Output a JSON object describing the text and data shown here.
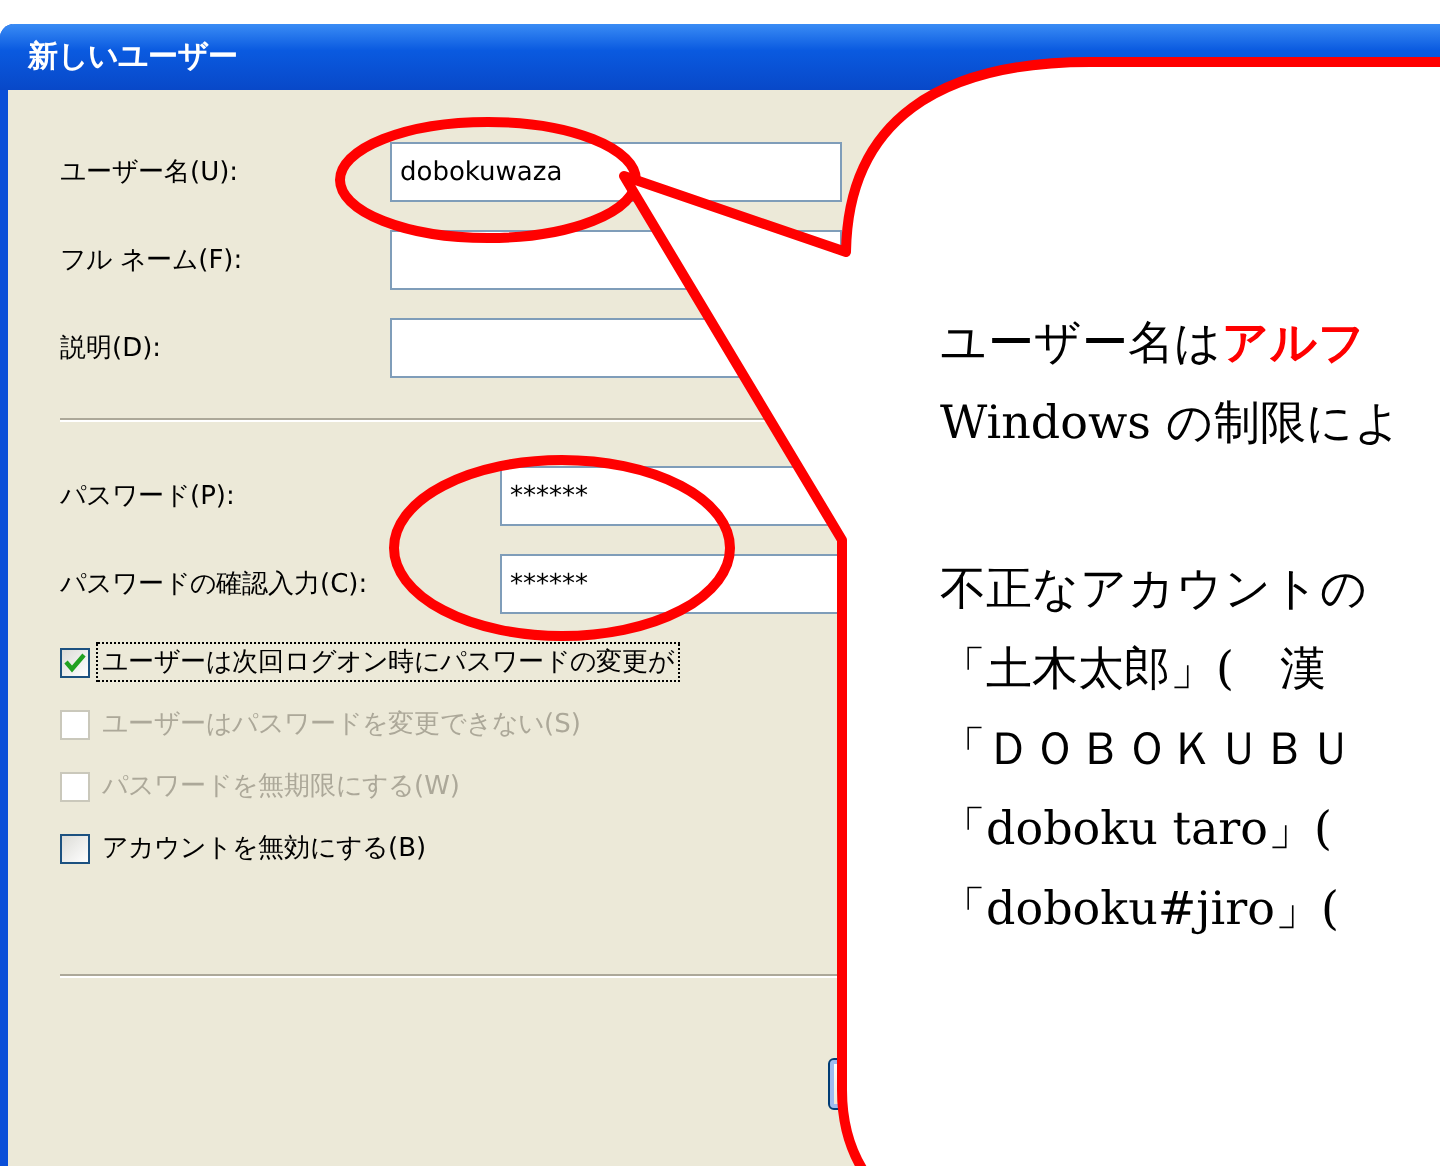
{
  "window": {
    "title": "新しいユーザー"
  },
  "fields": [
    {
      "label": "ユーザー名(U):",
      "value": "dobokuwaza"
    },
    {
      "label": "フル ネーム(F):"
    },
    {
      "label": "説明(D):"
    }
  ],
  "password_fields": [
    {
      "label": "パスワード(P):",
      "value": "******"
    },
    {
      "label": "パスワードの確認入力(C):",
      "value": "******"
    }
  ],
  "checkboxes": [
    {
      "label": "ユーザーは次回ログオン時にパスワードの変更が",
      "checked": true,
      "disabled": false,
      "focused": true
    },
    {
      "label": "ユーザーはパスワードを変更できない(S)",
      "checked": false,
      "disabled": true,
      "focused": false
    },
    {
      "label": "パスワードを無期限にする(W)",
      "checked": false,
      "disabled": true,
      "focused": false
    },
    {
      "label": "アカウントを無効にする(B)",
      "checked": false,
      "disabled": false,
      "focused": false
    }
  ],
  "callout": {
    "paragraphs": [
      [
        "ユーザー名は**アルフ**",
        "Windows の制限によ"
      ],
      [
        "不正なアカウントの",
        "「土木太郎」(　漢",
        "「ＤＯＢＯＫＵＢＵ",
        "「doboku taro」(",
        "「doboku#jiro」("
      ]
    ]
  }
}
